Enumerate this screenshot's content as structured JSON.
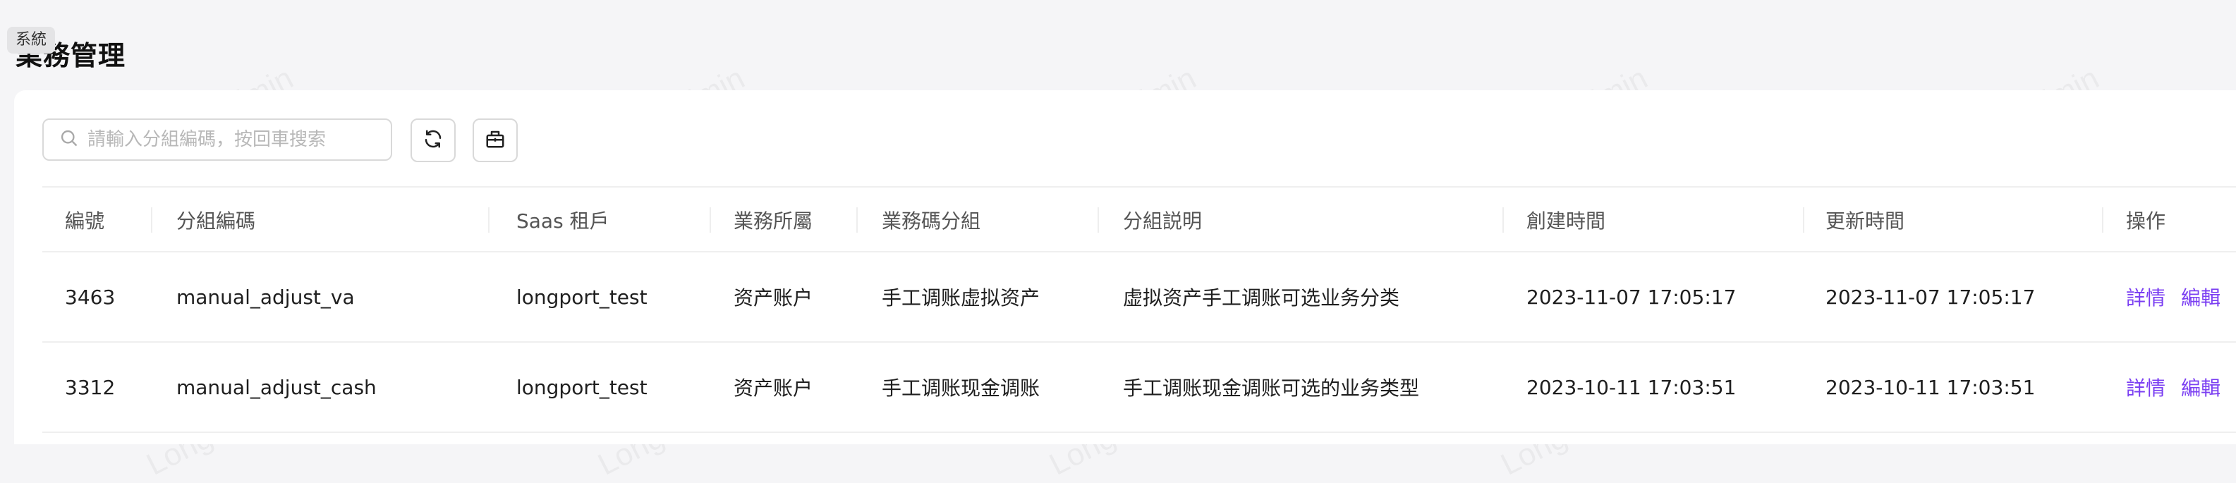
{
  "page": {
    "title": "業務管理",
    "system_badge": "系統"
  },
  "toolbar": {
    "search": {
      "placeholder": "請輸入分組編碼，按回車搜索",
      "value": ""
    },
    "refresh_icon": "refresh-icon",
    "column_settings_icon": "column-settings-icon"
  },
  "table": {
    "columns": {
      "id": "編號",
      "group_code": "分組編碼",
      "tenant": "Saas 租戶",
      "business": "業務所屬",
      "code_group": "業務碼分組",
      "description": "分組説明",
      "created": "創建時間",
      "updated": "更新時間",
      "actions": "操作"
    },
    "rows": [
      {
        "id": "3463",
        "group_code": "manual_adjust_va",
        "tenant": "longport_test",
        "business": "资产账户",
        "code_group": "手工调账虚拟资产",
        "description": "虚拟资产手工调账可选业务分类",
        "created": "2023-11-07 17:05:17",
        "updated": "2023-11-07 17:05:17",
        "detail": "詳情",
        "edit": "編輯"
      },
      {
        "id": "3312",
        "group_code": "manual_adjust_cash",
        "tenant": "longport_test",
        "business": "资产账户",
        "code_group": "手工调账现金调账",
        "description": "手工调账现金调账可选的业务类型",
        "created": "2023-10-11 17:03:51",
        "updated": "2023-10-11 17:03:51",
        "detail": "詳情",
        "edit": "編輯"
      }
    ]
  },
  "watermark": "LongPort Test Admin",
  "colors": {
    "link": "#7b3ff2",
    "background": "#f5f5f7",
    "card": "#ffffff"
  }
}
